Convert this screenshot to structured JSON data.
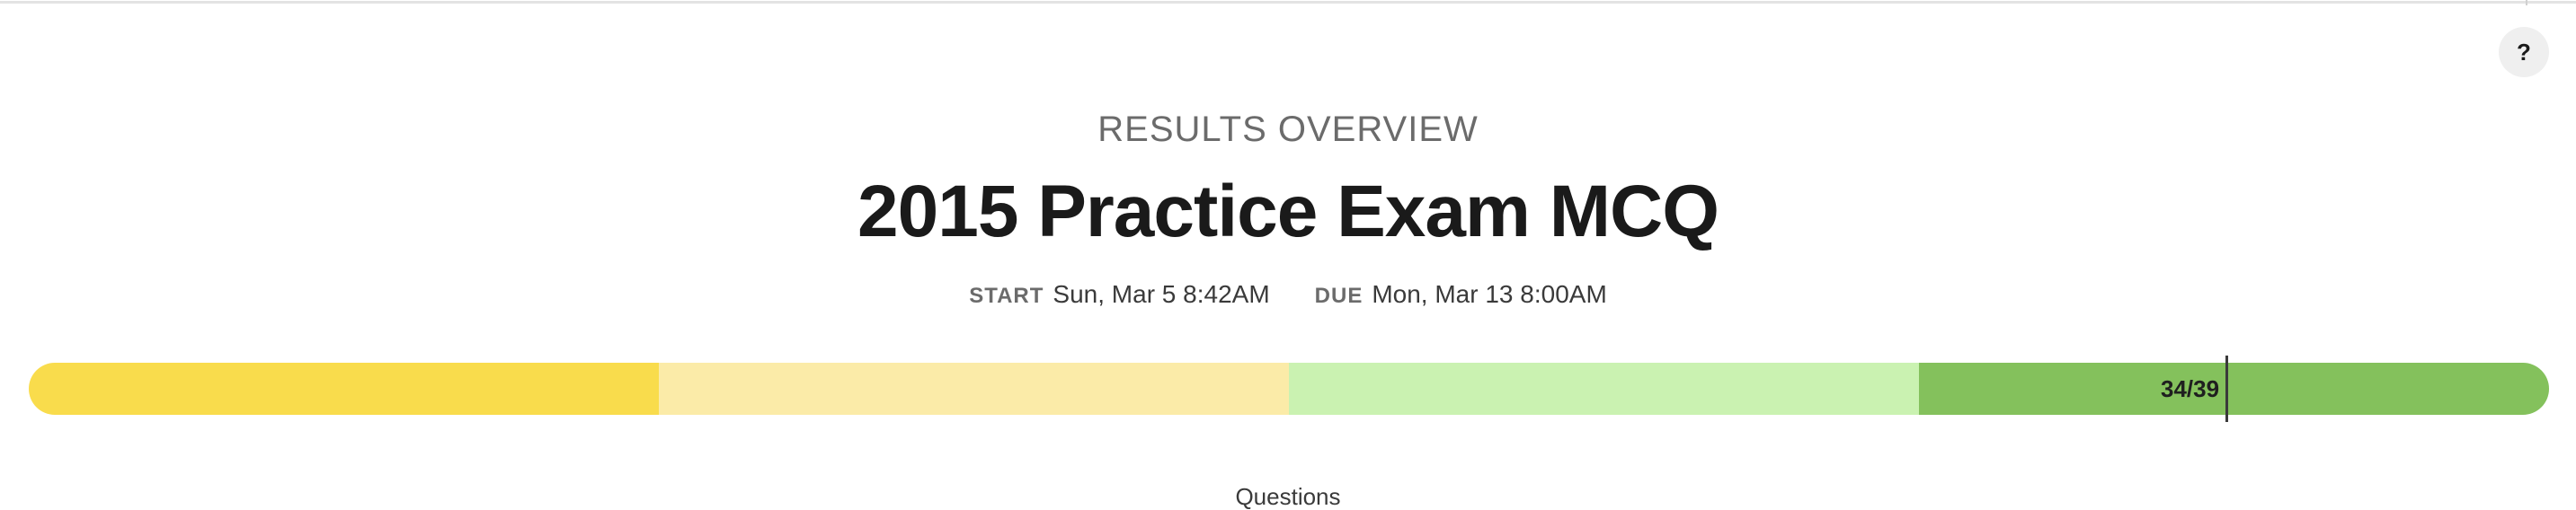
{
  "help": {
    "label": "?"
  },
  "overview": {
    "eyebrow": "RESULTS OVERVIEW",
    "title": "2015 Practice Exam MCQ"
  },
  "dates": {
    "start_label": "START",
    "start_value": "Sun, Mar 5 8:42AM",
    "due_label": "DUE",
    "due_value": "Mon, Mar 13 8:00AM"
  },
  "score": {
    "text": "34/39",
    "correct": 34,
    "total": 39,
    "bands": [
      "#f9dc4c",
      "#fbeba8",
      "#caf2b1",
      "#84c15c"
    ]
  },
  "footer": {
    "label": "Questions"
  }
}
